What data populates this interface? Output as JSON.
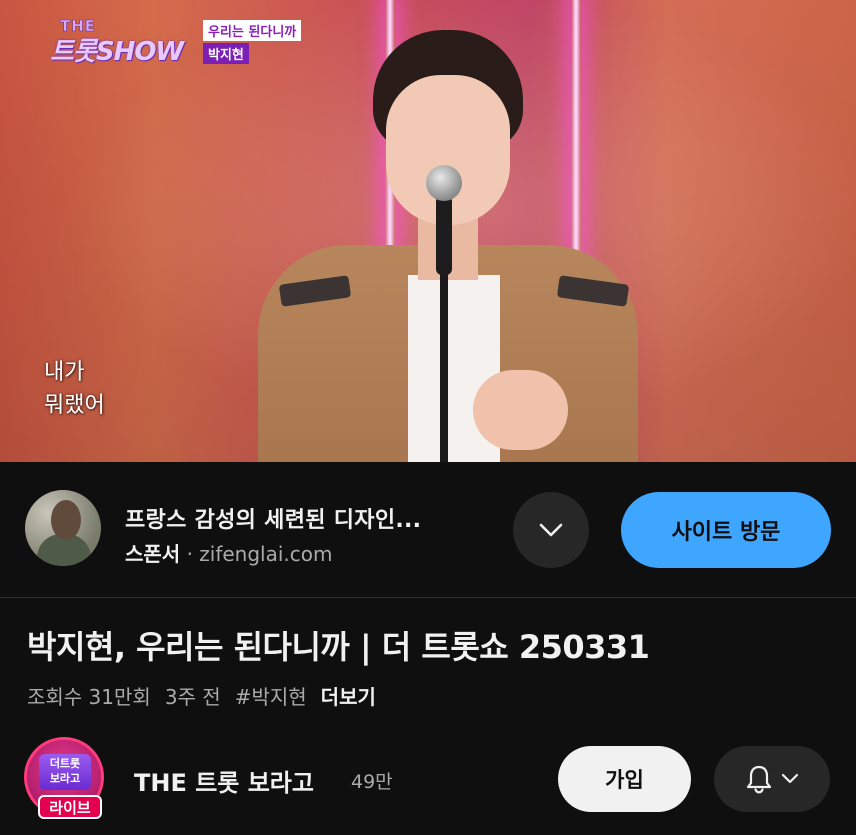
{
  "video": {
    "show_logo_the": "THE",
    "show_logo_name": "트롯SHOW",
    "song_tag": "우리는 된다니까",
    "artist_tag": "박지현",
    "lyrics": [
      "내가",
      "뭐랬어"
    ]
  },
  "ad": {
    "title": "프랑스 감성의 세련된 디자인...",
    "sponsor_label": "스폰서",
    "separator": "·",
    "domain": "zifenglai.com",
    "expand_icon": "chevron-down-icon",
    "visit_label": "사이트 방문"
  },
  "video_info": {
    "title": "박지현, 우리는 된다니까 | 더 트롯쇼 250331",
    "views": "조회수 31만회",
    "age": "3주 전",
    "hashtag": "#박지현",
    "more_label": "더보기"
  },
  "channel": {
    "avatar_text_line1": "더트롯",
    "avatar_text_line2": "보라고",
    "live_badge": "라이브",
    "name": "THE 트롯 보라고",
    "subscribers": "49만",
    "join_label": "가입",
    "bell_icon": "bell-icon",
    "dropdown_icon": "chevron-down-icon"
  },
  "colors": {
    "background": "#0f0f0f",
    "visit_button": "#3ea6ff",
    "join_button": "#f1f1f1",
    "secondary_text": "#aaaaaa",
    "live_badge": "#e3004f"
  }
}
